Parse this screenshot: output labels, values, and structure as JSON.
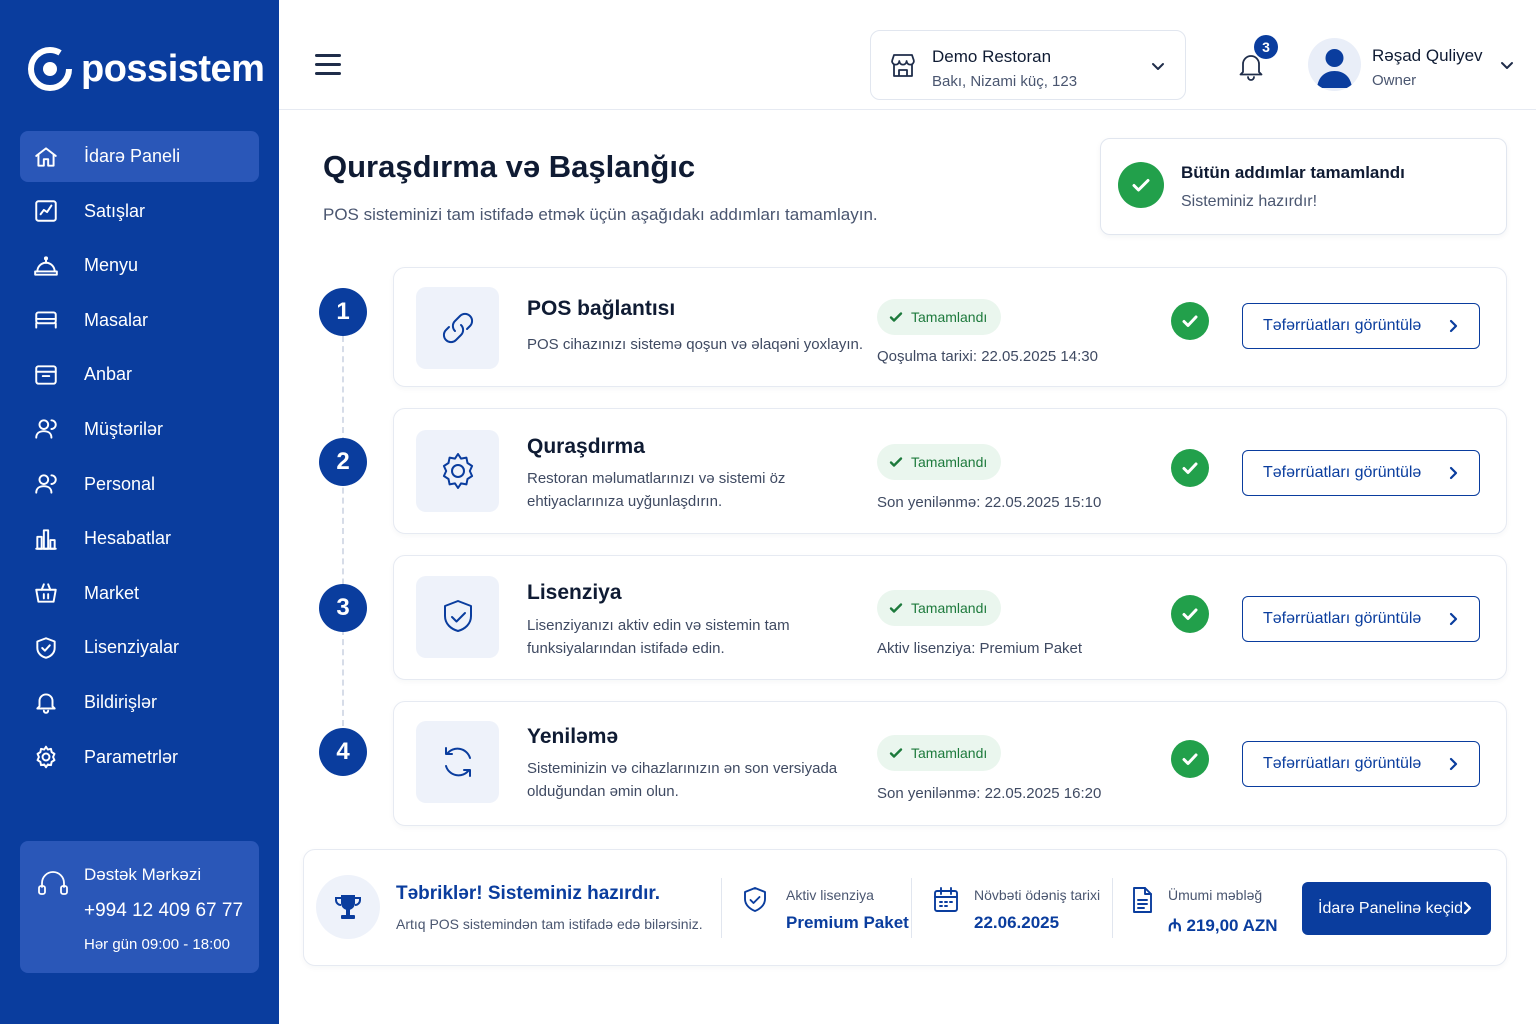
{
  "brand": {
    "name": "possistem"
  },
  "sidebar": {
    "items": [
      {
        "label": "İdarə Paneli",
        "icon": "home-icon",
        "active": true
      },
      {
        "label": "Satışlar",
        "icon": "chart-icon"
      },
      {
        "label": "Menyu",
        "icon": "menu-bell-icon"
      },
      {
        "label": "Masalar",
        "icon": "table-icon"
      },
      {
        "label": "Anbar",
        "icon": "box-icon"
      },
      {
        "label": "Müştərilər",
        "icon": "users-icon"
      },
      {
        "label": "Personal",
        "icon": "staff-icon"
      },
      {
        "label": "Hesabatlar",
        "icon": "bar-chart-icon"
      },
      {
        "label": "Market",
        "icon": "basket-icon"
      },
      {
        "label": "Lisenziyalar",
        "icon": "shield-icon"
      },
      {
        "label": "Bildirişlər",
        "icon": "bell-icon"
      },
      {
        "label": "Parametrlər",
        "icon": "gear-icon"
      }
    ],
    "support": {
      "title": "Dəstək Mərkəzi",
      "phone": "+994 12 409 67 77",
      "hours": "Hər gün 09:00 - 18:00"
    }
  },
  "header": {
    "store_name": "Demo Restoran",
    "store_address": "Bakı, Nizami küç, 123",
    "notification_count": "3",
    "user_name": "Rəşad Quliyev",
    "user_role": "Owner"
  },
  "page": {
    "title": "Quraşdırma və Başlanğıc",
    "subtitle": "POS sisteminizi tam istifadə etmək üçün aşağıdakı addımları tamamlayın."
  },
  "completion": {
    "title": "Bütün addımlar tamamlandı",
    "subtitle": "Sisteminiz hazırdır!"
  },
  "steps": [
    {
      "number": "1",
      "title": "POS bağlantısı",
      "description": "POS cihazınızı sistemə qoşun və əlaqəni yoxlayın.",
      "status": "Tamamlandı",
      "meta": "Qoşulma tarixi: 22.05.2025 14:30",
      "button": "Təfərrüatları görüntülə",
      "icon": "link-icon"
    },
    {
      "number": "2",
      "title": "Quraşdırma",
      "description": "Restoran məlumatlarınızı və sistemi öz ehtiyaclarınıza uyğunlaşdırın.",
      "status": "Tamamlandı",
      "meta": "Son yenilənmə: 22.05.2025 15:10",
      "button": "Təfərrüatları görüntülə",
      "icon": "gear-icon"
    },
    {
      "number": "3",
      "title": "Lisenziya",
      "description": "Lisenziyanızı aktiv edin və sistemin tam funksiyalarından istifadə edin.",
      "status": "Tamamlandı",
      "meta": "Aktiv lisenziya: Premium Paket",
      "button": "Təfərrüatları görüntülə",
      "icon": "shield-check-icon"
    },
    {
      "number": "4",
      "title": "Yeniləmə",
      "description": "Sisteminizin və cihazlarınızın ən son versiyada olduğundan əmin olun.",
      "status": "Tamamlandı",
      "meta": "Son yenilənmə: 22.05.2025 16:20",
      "button": "Təfərrüatları görüntülə",
      "icon": "refresh-icon"
    }
  ],
  "summary": {
    "title": "Təbriklər! Sisteminiz hazırdır.",
    "subtitle": "Artıq POS sistemindən tam istifadə edə bilərsiniz.",
    "license_label": "Aktiv lisenziya",
    "license_value": "Premium Paket",
    "payment_label": "Növbəti ödəniş tarixi",
    "payment_value": "22.06.2025",
    "total_label": "Ümumi məbləğ",
    "total_value": "₼ 219,00 AZN",
    "cta": "İdarə Panelinə keçid"
  },
  "colors": {
    "brand": "#0a3d9e",
    "sidebar_active": "#2a57b8",
    "success": "#22a04b",
    "success_bg": "#eaf6ee"
  }
}
